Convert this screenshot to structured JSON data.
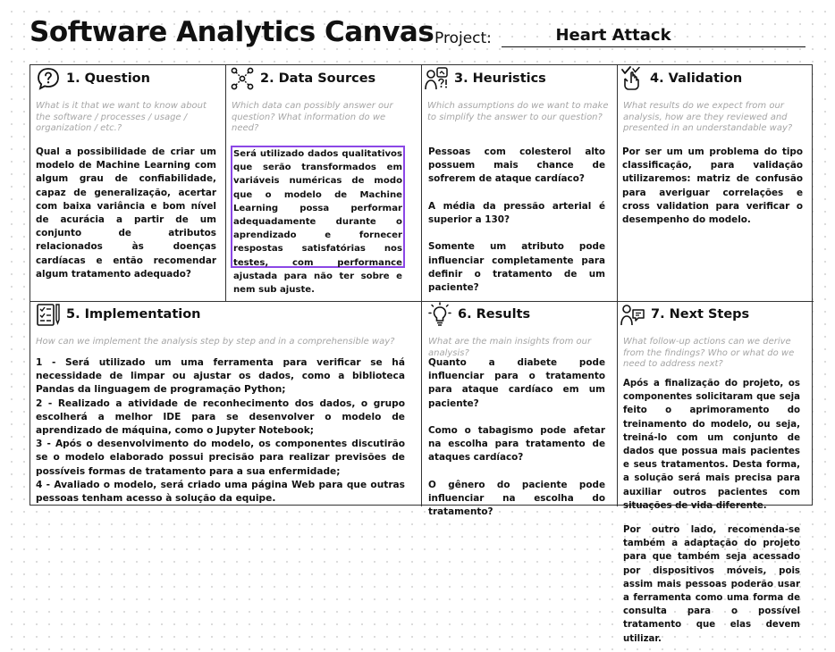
{
  "header": {
    "title": "Software Analytics Canvas",
    "project_label": "Project:",
    "project_value": "Heart Attack"
  },
  "sections": {
    "question": {
      "title": "1. Question",
      "hint": "What is it that we want to know about the software / processes / usage / organization / etc.?",
      "body": "Qual a possibilidade de criar um modelo de Machine Learning com algum grau de confiabilidade, capaz de generalização, acertar com baixa variância e bom nível de acurácia a partir de um conjunto de atributos relacionados às doenças cardíacas e então recomendar algum tratamento adequado?"
    },
    "data_sources": {
      "title": "2. Data Sources",
      "hint": "Which data can possibly answer our question? What information do we need?",
      "body": "Será utilizado dados qualitativos que serão transformados em variáveis numéricas de modo que o modelo de Machine Learning possa performar adequadamente durante o aprendizado e fornecer respostas satisfatórias nos testes, com performance ajustada para não ter sobre e nem sub ajuste."
    },
    "heuristics": {
      "title": "3. Heuristics",
      "hint": "Which assumptions do we want to make to simplify the answer to our question?",
      "items": [
        "Pessoas com colesterol alto possuem mais chance de sofrerem de ataque cardíaco?",
        "A média da pressão arterial é superior a 130?",
        "Somente um atributo pode influenciar completamente para definir o tratamento de um paciente?"
      ]
    },
    "validation": {
      "title": "4. Validation",
      "hint": "What results do we expect from our analysis, how are they reviewed and presented in an understandable way?",
      "body": "Por ser um um problema do tipo classificação, para validação utilizaremos: matriz de confusão para averiguar correlações e cross validation para verificar o desempenho do modelo."
    },
    "implementation": {
      "title": "5. Implementation",
      "hint": "How can we implement the analysis step by step and in a comprehensible way?",
      "items": [
        "1 - Será utilizado um uma ferramenta para verificar se há necessidade de limpar ou ajustar os dados, como a biblioteca Pandas da linguagem de programação Python;",
        "2 - Realizado a atividade de reconhecimento dos dados, o grupo escolherá a melhor IDE para se desenvolver o modelo de aprendizado de máquina, como o  Jupyter Notebook;",
        "3 - Após o desenvolvimento do modelo, os componentes discutirão se o modelo elaborado possui precisão para realizar previsões de possíveis formas de tratamento para a sua enfermidade;",
        "4 - Avaliado o modelo, será criado uma página Web para que outras pessoas tenham acesso à solução da equipe."
      ]
    },
    "results": {
      "title": "6. Results",
      "hint": "What are the main insights from our analysis?",
      "items": [
        "Quanto a diabete pode influenciar para o tratamento para ataque cardíaco em um paciente?",
        "Como o tabagismo pode afetar na escolha para tratamento de ataques cardíaco?",
        "O gênero do paciente pode influenciar na escolha do tratamento?"
      ]
    },
    "next_steps": {
      "title": "7. Next Steps",
      "hint": "What follow-up actions can we derive from the findings? Who or what do we need to address next?",
      "body_1": "Após a finalização do projeto, os componentes solicitaram que seja feito o aprimoramento do treinamento do modelo, ou seja, treiná-lo com um conjunto de dados que possua mais pacientes e seus tratamentos. Desta forma, a solução será mais precisa para auxiliar outros pacientes com situações de vida diferente.",
      "body_2": "Por outro lado, recomenda-se também a adaptação do projeto para que também seja acessado por dispositivos móveis, pois assim mais pessoas poderão usar a ferramenta como uma forma de consulta para o possível tratamento que elas devem utilizar."
    }
  }
}
